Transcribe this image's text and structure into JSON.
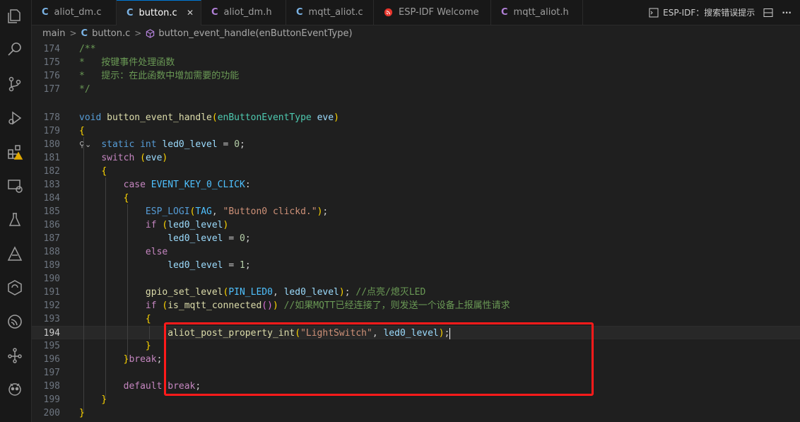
{
  "tabs": [
    {
      "label": "aliot_dm.c",
      "icon": "C",
      "kind": "c"
    },
    {
      "label": "button.c",
      "icon": "C",
      "kind": "c",
      "active": true
    },
    {
      "label": "aliot_dm.h",
      "icon": "C",
      "kind": "h"
    },
    {
      "label": "mqtt_aliot.c",
      "icon": "C",
      "kind": "c"
    },
    {
      "label": "ESP-IDF Welcome",
      "icon": "espressif-icon",
      "kind": "esp"
    },
    {
      "label": "mqtt_aliot.h",
      "icon": "C",
      "kind": "h"
    }
  ],
  "toolbar": {
    "esp_action": "ESP-IDF：搜索错误提示",
    "more": "···"
  },
  "breadcrumb": {
    "branch": "main",
    "file": "button.c",
    "symbol": "button_event_handle(enButtonEventType)",
    "sep": ">"
  },
  "current_line": 194,
  "lines": [
    {
      "n": "174",
      "code": "/**"
    },
    {
      "n": "175",
      "code": "*   按键事件处理函数"
    },
    {
      "n": "176",
      "code": "*   提示：在此函数中增加需要的功能"
    },
    {
      "n": "177",
      "code": "*/"
    },
    {
      "n": "178",
      "code": "void button_event_handle(enButtonEventType eve)"
    },
    {
      "n": "179",
      "code": "{"
    },
    {
      "n": "180",
      "code": "    static int led0_level = 0;"
    },
    {
      "n": "181",
      "code": "    switch (eve)"
    },
    {
      "n": "182",
      "code": "    {"
    },
    {
      "n": "183",
      "code": "        case EVENT_KEY_0_CLICK:"
    },
    {
      "n": "184",
      "code": "        {"
    },
    {
      "n": "185",
      "code": "            ESP_LOGI(TAG, \"Button0 clickd.\");"
    },
    {
      "n": "186",
      "code": "            if (led0_level)"
    },
    {
      "n": "187",
      "code": "                led0_level = 0;"
    },
    {
      "n": "188",
      "code": "            else"
    },
    {
      "n": "189",
      "code": "                led0_level = 1;"
    },
    {
      "n": "190",
      "code": ""
    },
    {
      "n": "191",
      "code": "            gpio_set_level(PIN_LED0, led0_level); //点亮/熄灭LED"
    },
    {
      "n": "192",
      "code": "            if (is_mqtt_connected()) //如果MQTT已经连接了，则发送一个设备上报属性请求"
    },
    {
      "n": "193",
      "code": "            {"
    },
    {
      "n": "194",
      "code": "                aliot_post_property_int(\"LightSwitch\", led0_level);"
    },
    {
      "n": "195",
      "code": "            }"
    },
    {
      "n": "196",
      "code": "        }break;"
    },
    {
      "n": "197",
      "code": ""
    },
    {
      "n": "198",
      "code": "        default:break;"
    },
    {
      "n": "199",
      "code": "    }"
    },
    {
      "n": "200",
      "code": "}"
    }
  ],
  "colors": {
    "highlight_box": "#ff1a1a",
    "accent": "#0078d4"
  }
}
